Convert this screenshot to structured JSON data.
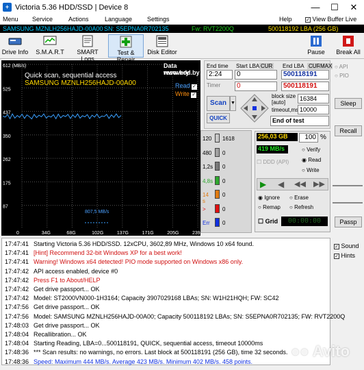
{
  "window": {
    "title": "Victoria 5.36 HDD/SSD | Device 8"
  },
  "menu": [
    "Menu",
    "Service",
    "Actions",
    "Language",
    "Settings",
    "Help"
  ],
  "view_buffer": "View Buffer Live",
  "infobar": {
    "model": "SAMSUNG MZNLH256HAJD-00A00",
    "serial": "SN: S5EPNA0R702135",
    "firmware": "Fw: RVT2200Q",
    "capacity": "500118192 LBA (256 GB)"
  },
  "toolbar": {
    "drive_info": "Drive Info",
    "smart": "S.M.A.R.T",
    "smart_logs": "SMART Logs",
    "test_repair": "Test & Repair",
    "disk_editor": "Disk Editor",
    "pause": "Pause",
    "break_all": "Break All"
  },
  "graph": {
    "y_labels": [
      "612 (MB/s)",
      "525",
      "437",
      "350",
      "262",
      "175",
      "87"
    ],
    "x_labels": [
      "0",
      "34G",
      "68G",
      "102G",
      "137G",
      "171G",
      "205G",
      "239G"
    ],
    "title": "Quick scan, sequential access",
    "device": "SAMSUNG MZNLH256HAJD-00A00",
    "data_recovery": "Data recovery",
    "site": "www.hdd.by",
    "read": "Read",
    "write": "Write",
    "speed_label": "807,5 MB/s",
    "ymax": 612,
    "speed_values": [
      420,
      416,
      425,
      410,
      428,
      412,
      422,
      415,
      427,
      411,
      424,
      418,
      409,
      426,
      414,
      423,
      417,
      428,
      412,
      420,
      416,
      425,
      410,
      427,
      413,
      422,
      418,
      426,
      411,
      424,
      415,
      428,
      412,
      421,
      417,
      425,
      410,
      423,
      416,
      427,
      413,
      420,
      418,
      426,
      411,
      424,
      415,
      428,
      414,
      422
    ]
  },
  "controls": {
    "end_time_label": "End time",
    "end_time": "2:24",
    "timer": "Timer",
    "timer_val": "0",
    "start_lba_label": "Start LBA",
    "cur": "CUR",
    "start_lba": "0",
    "start_lba2": "0",
    "end_lba_label": "End LBA",
    "max": "MAX",
    "end_lba": "500118191",
    "end_lba2": "500118191",
    "block_size_label": "block size",
    "auto": "auto",
    "block_size": "16384",
    "timeout_label": "timeout,ms",
    "timeout": "10000",
    "scan": "Scan",
    "quick": "QUICK",
    "end_of_test": "End of test",
    "api": "API",
    "pio": "PIO",
    "sleep": "Sleep",
    "recall": "Recall",
    "passp": "Passp"
  },
  "stats": {
    "size": "256,03 GB",
    "percent": "100",
    "percent_sign": "%",
    "speed": "419 MB/s",
    "ddd": "DDD (API)",
    "verify": "Verify",
    "read": "Read",
    "write": "Write",
    "ignore": "Ignore",
    "erase": "Erase",
    "remap": "Remap",
    "refresh": "Refresh",
    "grid": "Grid",
    "grid_time": "00:00:00"
  },
  "legend": [
    {
      "label": "120",
      "count": "1618",
      "color": "#c8c8c8"
    },
    {
      "label": "480",
      "count": "0",
      "color": "#a0a0a0"
    },
    {
      "label": "1,2s",
      "count": "0",
      "color": "#787878"
    },
    {
      "label": "4,8s",
      "count": "0",
      "color": "#2ea82e"
    },
    {
      "label": "14 s",
      "count": "0",
      "color": "#e07a10"
    },
    {
      "label": ">",
      "count": "0",
      "color": "#e01010"
    },
    {
      "label": "Err",
      "count": "0",
      "color": "#1030e0"
    }
  ],
  "side": {
    "sound": "Sound",
    "hints": "Hints"
  },
  "log": [
    {
      "time": "17:47:41",
      "msg": "Starting Victoria 5.36 HDD/SSD. 12xCPU, 3602,89 MHz, Windows 10 x64 found.",
      "color": "#000000"
    },
    {
      "time": "17:47:41",
      "msg": "[Hint] Recommend 32-bit Windows XP for a best work!",
      "color": "#d01010"
    },
    {
      "time": "17:47:41",
      "msg": "Warning! Windows x64 detected! PIO mode supported on Windows x86 only.",
      "color": "#d01010"
    },
    {
      "time": "17:47:42",
      "msg": "API access enabled, device #0",
      "color": "#000000"
    },
    {
      "time": "17:47:42",
      "msg": "Press F1 to About/HELP",
      "color": "#d01010"
    },
    {
      "time": "17:47:42",
      "msg": "Get drive passport... OK",
      "color": "#000000"
    },
    {
      "time": "17:47:42",
      "msg": "Model: ST2000VN000-1H3164; Capacity 3907029168 LBAs; SN: W1H21HQH; FW: SC42",
      "color": "#000000"
    },
    {
      "time": "17:47:56",
      "msg": "Get drive passport... OK",
      "color": "#000000"
    },
    {
      "time": "17:47:56",
      "msg": "Model: SAMSUNG MZNLH256HAJD-00A00; Capacity 500118192 LBAs; SN: S5EPNA0R702135; FW: RVT2200Q",
      "color": "#000000"
    },
    {
      "time": "17:48:03",
      "msg": "Get drive passport... OK",
      "color": "#000000"
    },
    {
      "time": "17:48:04",
      "msg": "Recallibration... OK",
      "color": "#000000"
    },
    {
      "time": "17:48:04",
      "msg": "Starting Reading, LBA=0...500118191, QUICK, sequential access, timeout 10000ms",
      "color": "#000000"
    },
    {
      "time": "17:48:36",
      "msg": "*** Scan results: no warnings, no errors. Last block at 500118191 (256 GB), time 32 seconds.",
      "color": "#000000"
    },
    {
      "time": "17:48:36",
      "msg": "Speed: Maximum 444 MB/s. Average 423 MB/s. Minimum 402 MB/s. 458 points.",
      "color": "#1030e0"
    }
  ],
  "watermark": "Avito"
}
